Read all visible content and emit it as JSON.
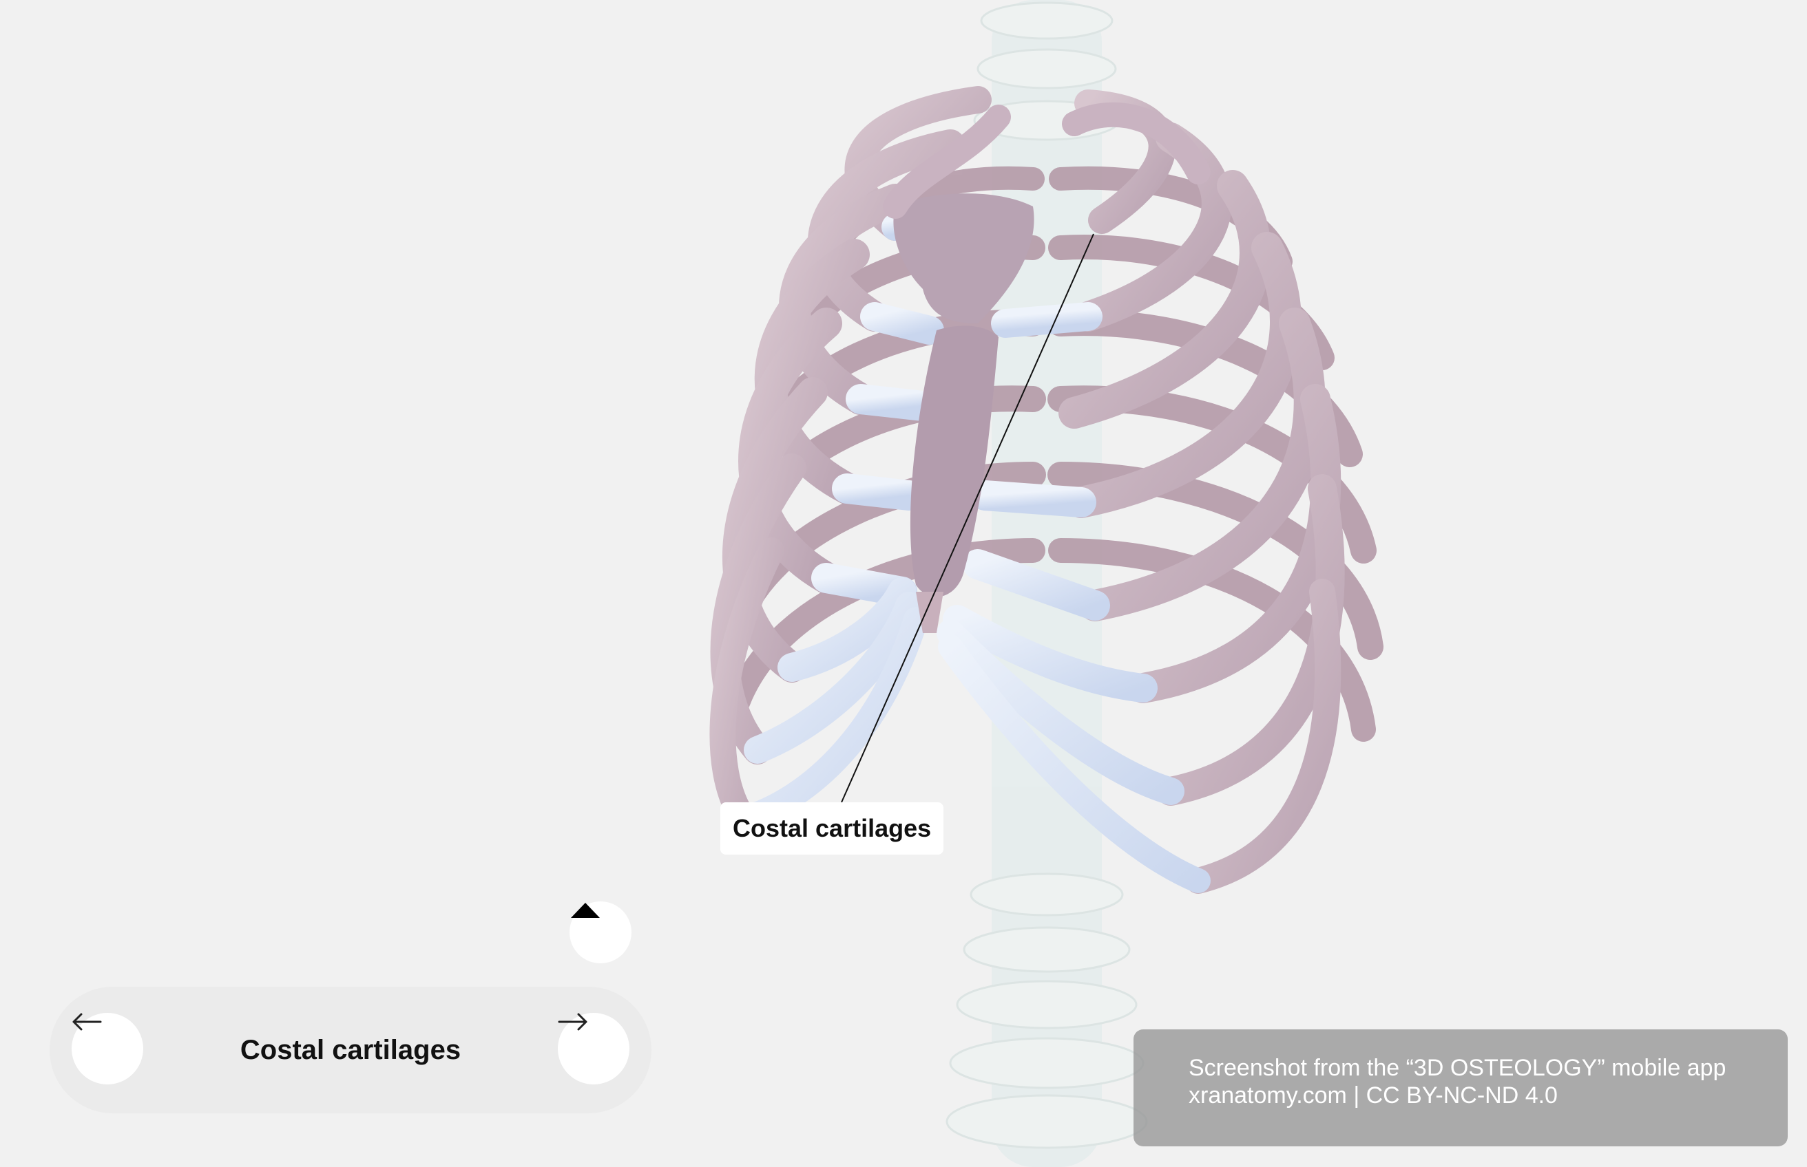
{
  "viewer": {
    "model_icon": "rib-cage-3d-model"
  },
  "label": {
    "text": "Costal cartilages"
  },
  "controls": {
    "collapse_icon": "caret-up-icon",
    "prev_icon": "arrow-left-icon",
    "next_icon": "arrow-right-icon",
    "current_structure": "Costal cartilages"
  },
  "watermark": {
    "line1": "Screenshot from the “3D OSTEOLOGY” mobile app",
    "line2": "xranatomy.com | CC BY-NC-ND 4.0"
  },
  "colors": {
    "background": "#f1f1f1",
    "bone": "#c9b4c0",
    "cartilage": "#dbe6f6"
  }
}
